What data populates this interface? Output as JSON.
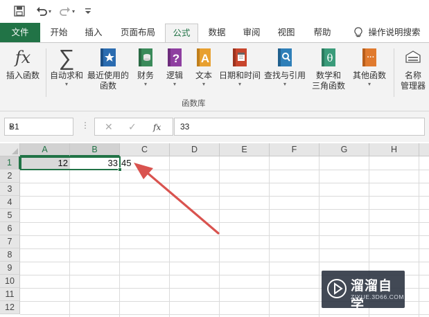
{
  "quick_access": {
    "save_icon": "save-icon",
    "undo_icon": "undo-icon",
    "redo_icon": "redo-icon",
    "customize_icon": "customize-qat-icon"
  },
  "tabs": [
    {
      "label": "文件"
    },
    {
      "label": "开始"
    },
    {
      "label": "插入"
    },
    {
      "label": "页面布局"
    },
    {
      "label": "公式"
    },
    {
      "label": "数据"
    },
    {
      "label": "审阅"
    },
    {
      "label": "视图"
    },
    {
      "label": "帮助"
    }
  ],
  "tell_me": {
    "label": "操作说明搜索",
    "icon": "lightbulb-icon"
  },
  "ribbon": {
    "buttons": [
      {
        "line1": "插入函数",
        "line2": ""
      },
      {
        "line1": "自动求和",
        "line2": ""
      },
      {
        "line1": "最近使用的",
        "line2": "函数"
      },
      {
        "line1": "财务",
        "line2": ""
      },
      {
        "line1": "逻辑",
        "line2": ""
      },
      {
        "line1": "文本",
        "line2": ""
      },
      {
        "line1": "日期和时间",
        "line2": ""
      },
      {
        "line1": "查找与引用",
        "line2": ""
      },
      {
        "line1": "数学和",
        "line2": "三角函数"
      },
      {
        "line1": "其他函数",
        "line2": ""
      },
      {
        "line1": "名称",
        "line2": "管理器"
      }
    ],
    "group_label": "函数库",
    "fx_glyph": "fx",
    "sigma_glyph": "∑",
    "logic_glyph": "?",
    "text_glyph": "A",
    "math_glyph": "θ",
    "more_glyph": "···"
  },
  "formula_bar": {
    "name_box": "B1",
    "fx_label": "fx",
    "cancel_glyph": "✕",
    "enter_glyph": "✓",
    "formula": "33"
  },
  "columns": [
    "A",
    "B",
    "C",
    "D",
    "E",
    "F",
    "G",
    "H"
  ],
  "rows": [
    "1",
    "2",
    "3",
    "4",
    "5",
    "6",
    "7",
    "8",
    "9",
    "10",
    "11",
    "12"
  ],
  "cells": {
    "A1": "12",
    "B1": "33",
    "C1": "45"
  },
  "colors": {
    "excel_green": "#217346",
    "arrow_red": "#d9534f"
  },
  "watermark": {
    "title": "溜溜自学",
    "subtitle": "ZIXUE.3D66.COM"
  }
}
